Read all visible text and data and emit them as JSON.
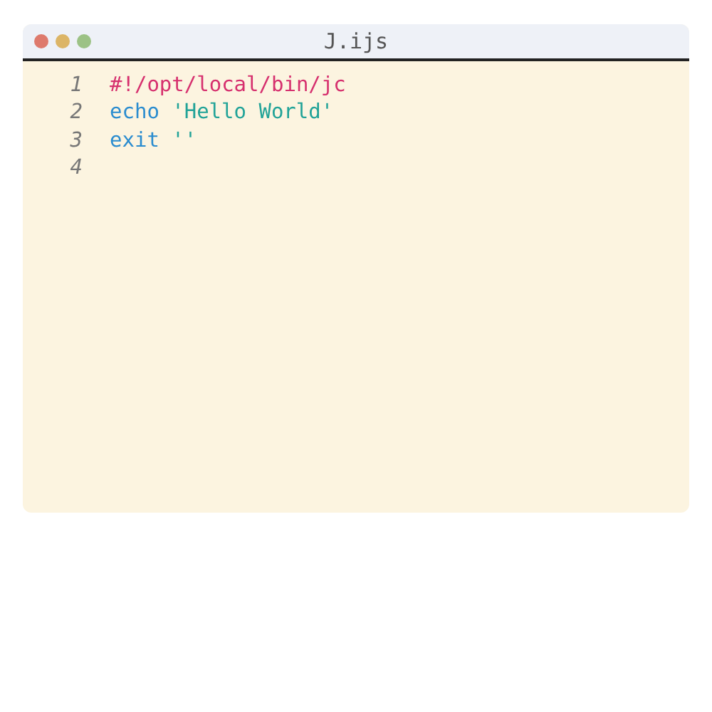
{
  "window": {
    "title": "J.ijs"
  },
  "lines": [
    {
      "number": "1",
      "tokens": [
        {
          "kind": "shebang",
          "text": "#!/opt/local/bin/jc"
        }
      ]
    },
    {
      "number": "2",
      "tokens": [
        {
          "kind": "keyword",
          "text": "echo"
        },
        {
          "kind": "string",
          "text": "'Hello World'"
        }
      ]
    },
    {
      "number": "3",
      "tokens": [
        {
          "kind": "keyword",
          "text": "exit"
        },
        {
          "kind": "string",
          "text": "''"
        }
      ]
    },
    {
      "number": "4"
    }
  ]
}
